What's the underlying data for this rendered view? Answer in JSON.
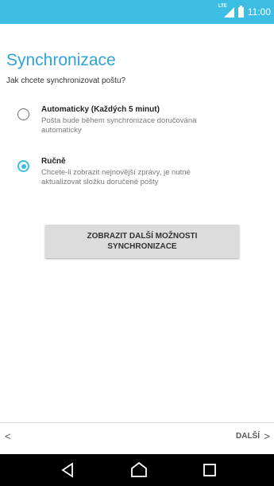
{
  "status_bar": {
    "network": "LTE",
    "time": "11:00",
    "color": "#3bbde4"
  },
  "screen": {
    "title": "Synchronizace",
    "subtitle": "Jak chcete synchronizovat poštu?"
  },
  "options": [
    {
      "label": "Automaticky (Každých 5 minut)",
      "description_line1": "Pošta bude během synchronizace doručována",
      "description_line2": "automaticky",
      "selected": false
    },
    {
      "label": "Ručně",
      "description_line1": "Chcete-li zobrazit nejnovější zprávy, je nutné",
      "description_line2": "aktualizovat složku doručené pošty",
      "selected": true
    }
  ],
  "more_button": {
    "line1": "ZOBRAZIT DALŠÍ MOŽNOSTI",
    "line2": "SYNCHRONIZACE"
  },
  "footer": {
    "back_glyph": "<",
    "next_label": "DALŠÍ",
    "next_glyph": ">"
  },
  "nav_bar": {
    "icons": [
      "back-icon",
      "home-icon",
      "recents-icon"
    ]
  },
  "colors": {
    "accent": "#3bbde4",
    "title": "#2fa4d8",
    "button_bg": "#dcdcdc"
  }
}
